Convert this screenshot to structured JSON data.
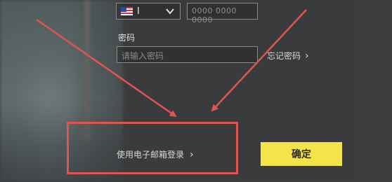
{
  "phone": {
    "country_code": "I",
    "placeholder": "0000 0000 0000"
  },
  "password": {
    "label": "密码",
    "placeholder": "请输入密码",
    "forgot_label": "忘记密码"
  },
  "email_login_label": "使用电子邮箱登录",
  "confirm_label": "确定",
  "colors": {
    "confirm_bg": "#f3e44a",
    "annotation": "#e25454"
  }
}
